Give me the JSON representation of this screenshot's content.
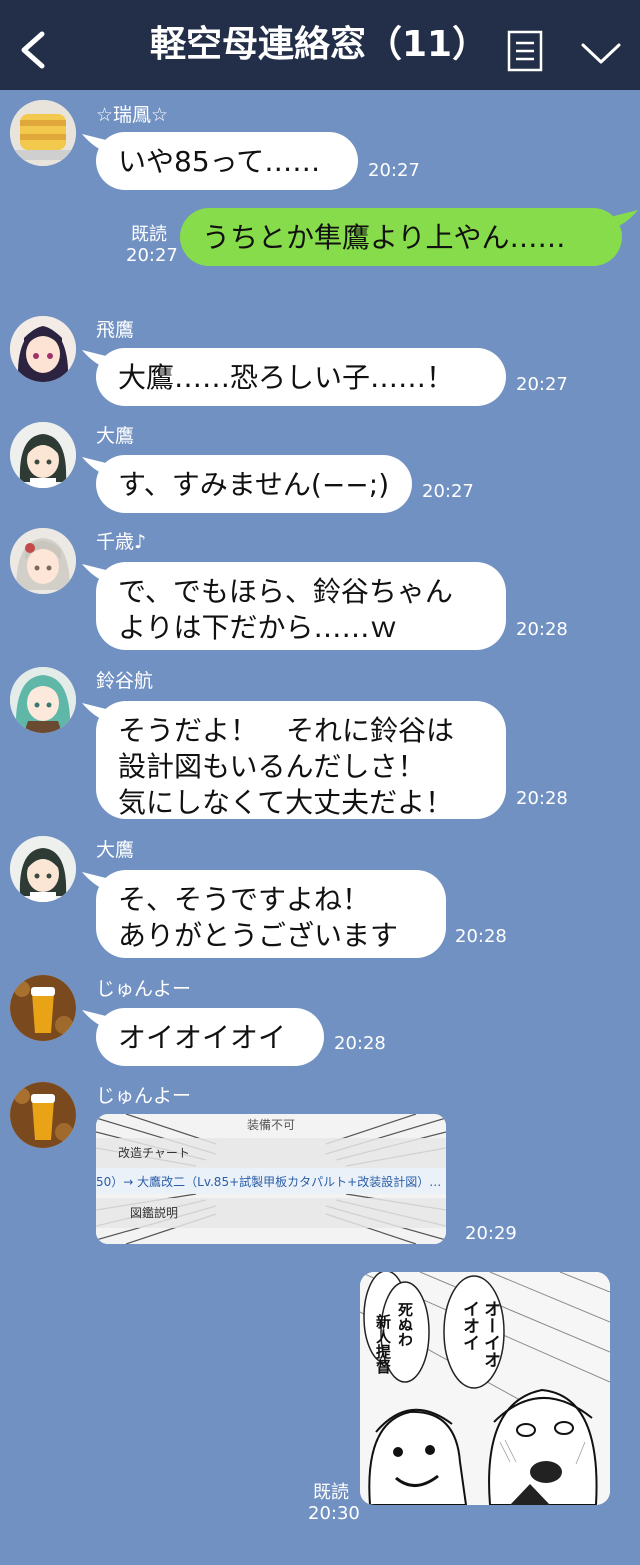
{
  "header": {
    "title": "軽空母連絡窓（11）",
    "back_icon": "chevron-left-icon",
    "menu_icon": "menu-icon",
    "expand_icon": "chevron-down-icon"
  },
  "colors": {
    "background": "#7191c2",
    "header": "#232e48",
    "bubble_in": "#ffffff",
    "bubble_out": "#86dc4b"
  },
  "messages": [
    {
      "sender": "☆瑞鳳☆",
      "text": "いや85って……",
      "time": "20:27"
    },
    {
      "text": "うちとか隼鷹より上やん……",
      "read": "既読",
      "time": "20:27"
    },
    {
      "sender": "飛鷹",
      "text": "大鷹……恐ろしい子……！",
      "time": "20:27"
    },
    {
      "sender": "大鷹",
      "text": "す、すみません(−−;)",
      "time": "20:27"
    },
    {
      "sender": "千歳♪",
      "text": "で、でもほら、鈴谷ちゃん\nよりは下だから……ｗ",
      "time": "20:28"
    },
    {
      "sender": "鈴谷航",
      "text": "そうだよ！　それに鈴谷は\n設計図もいるんだしさ！\n気にしなくて大丈夫だよ！",
      "time": "20:28"
    },
    {
      "sender": "大鷹",
      "text": "そ、そうですよね！\nありがとうございます",
      "time": "20:28"
    },
    {
      "sender": "じゅんよー",
      "text": "オイオイオイ",
      "time": "20:28"
    },
    {
      "sender": "じゅんよー",
      "time": "20:29",
      "image": {
        "header": "装備不可",
        "row1": "改造チャート",
        "row2": "50）→ 大鷹改二（Lv.85+試製甲板カタパルト+改装設計図）…",
        "row3": "図鑑説明"
      }
    },
    {
      "read": "既読",
      "time": "20:30",
      "image": {
        "speech_left": "新人提督",
        "speech_mid": "死ぬわ",
        "speech_right": "オーイオイオイ"
      }
    }
  ]
}
